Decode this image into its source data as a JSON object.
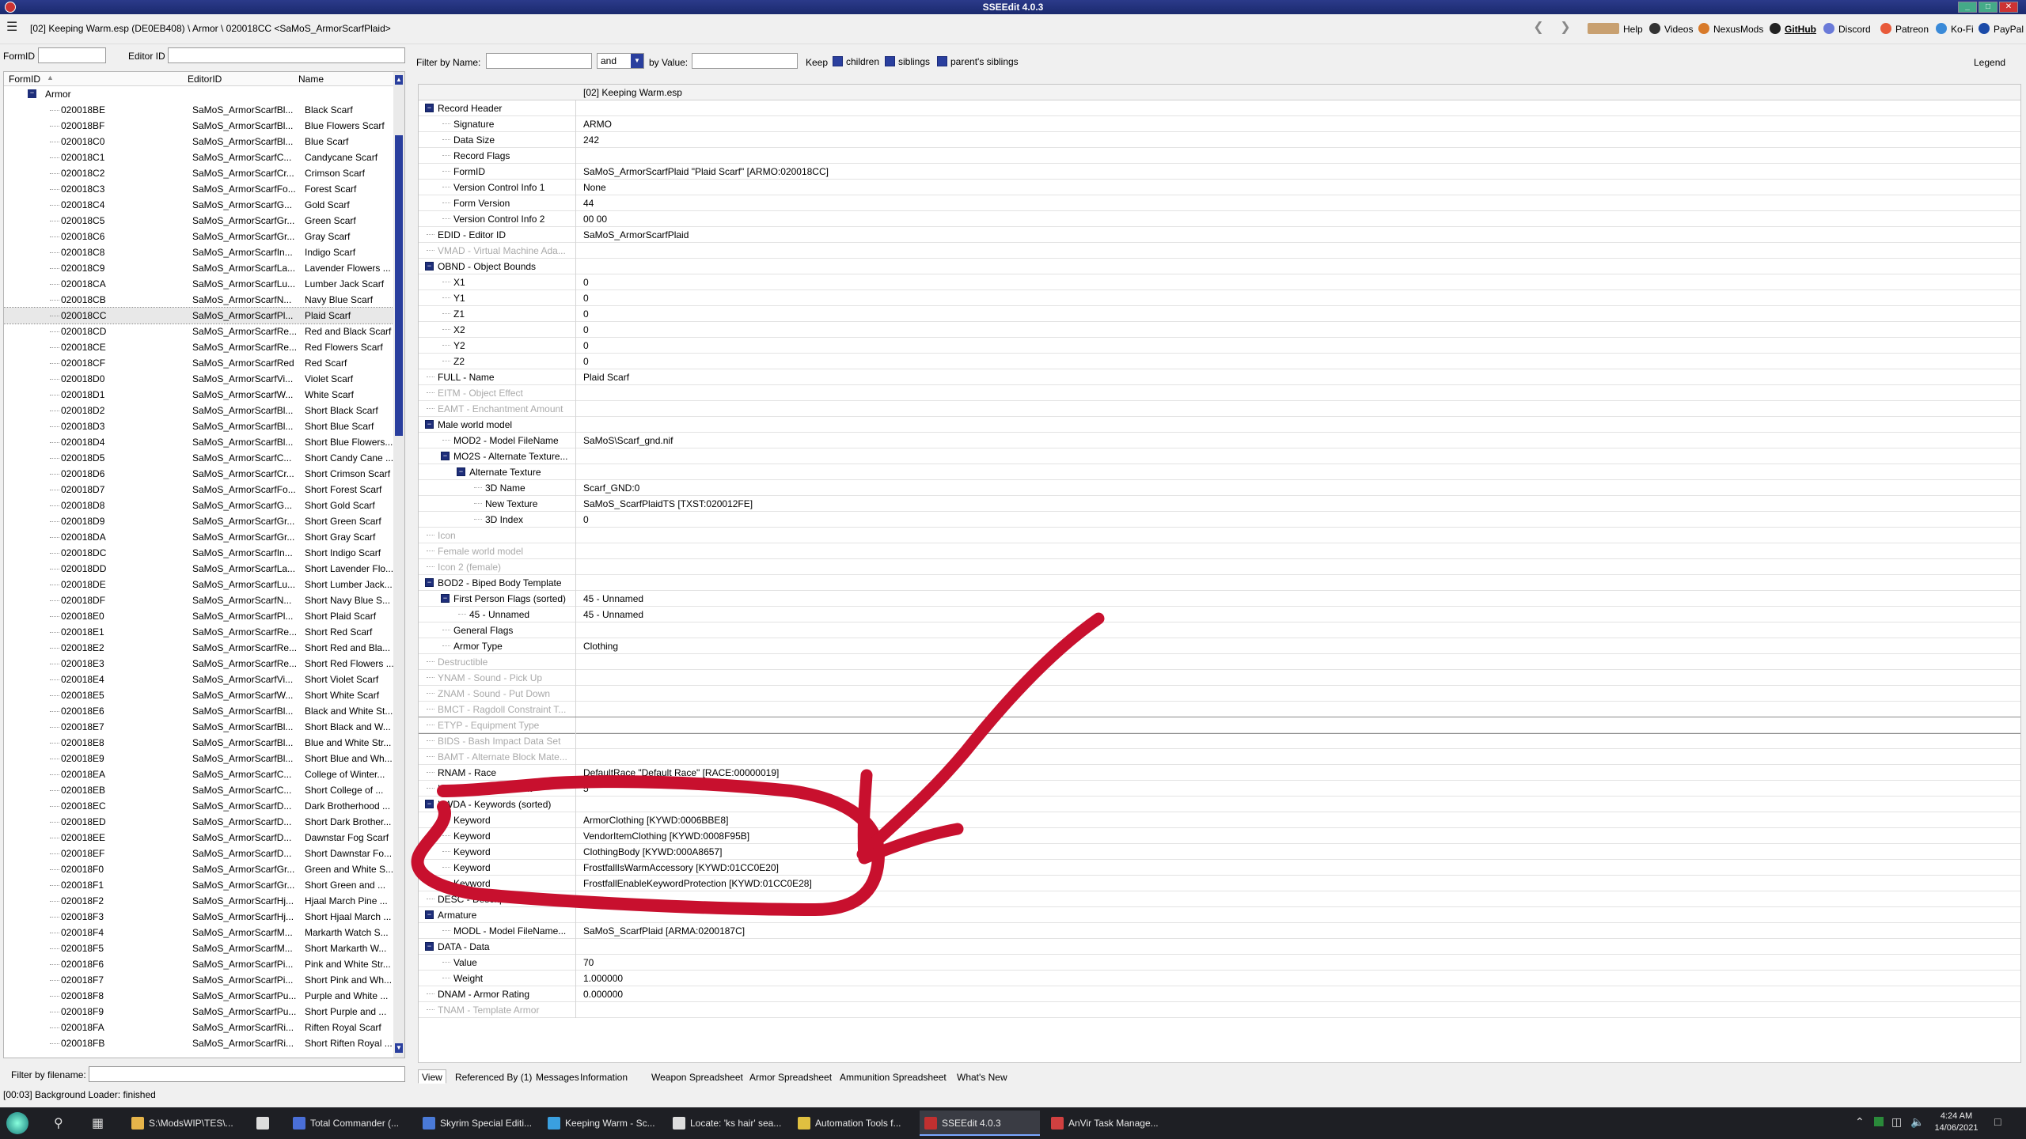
{
  "window": {
    "title": "SSEEdit 4.0.3",
    "controls": [
      "_",
      "□",
      "✕"
    ]
  },
  "toolbar": {
    "path": "[02] Keeping Warm.esp (DE0EB408) \\ Armor \\ 020018CC <SaMoS_ArmorScarfPlaid>",
    "links": [
      "Help",
      "Videos",
      "NexusMods",
      "GitHub",
      "Discord",
      "Patreon",
      "Ko-Fi",
      "PayPal"
    ]
  },
  "left": {
    "formid_label": "FormID",
    "editorid_label": "Editor ID",
    "formid_value": "",
    "editorid_value": "",
    "columns": [
      "FormID",
      "EditorID",
      "Name"
    ],
    "group": "Armor",
    "rows": [
      {
        "id": "020018BE",
        "eid": "SaMoS_ArmorScarfBl...",
        "name": "Black Scarf"
      },
      {
        "id": "020018BF",
        "eid": "SaMoS_ArmorScarfBl...",
        "name": "Blue Flowers Scarf"
      },
      {
        "id": "020018C0",
        "eid": "SaMoS_ArmorScarfBl...",
        "name": "Blue Scarf"
      },
      {
        "id": "020018C1",
        "eid": "SaMoS_ArmorScarfC...",
        "name": "Candycane Scarf"
      },
      {
        "id": "020018C2",
        "eid": "SaMoS_ArmorScarfCr...",
        "name": "Crimson Scarf"
      },
      {
        "id": "020018C3",
        "eid": "SaMoS_ArmorScarfFo...",
        "name": "Forest Scarf"
      },
      {
        "id": "020018C4",
        "eid": "SaMoS_ArmorScarfG...",
        "name": "Gold Scarf"
      },
      {
        "id": "020018C5",
        "eid": "SaMoS_ArmorScarfGr...",
        "name": "Green Scarf"
      },
      {
        "id": "020018C6",
        "eid": "SaMoS_ArmorScarfGr...",
        "name": "Gray Scarf"
      },
      {
        "id": "020018C8",
        "eid": "SaMoS_ArmorScarfIn...",
        "name": "Indigo Scarf"
      },
      {
        "id": "020018C9",
        "eid": "SaMoS_ArmorScarfLa...",
        "name": "Lavender Flowers ..."
      },
      {
        "id": "020018CA",
        "eid": "SaMoS_ArmorScarfLu...",
        "name": "Lumber Jack Scarf"
      },
      {
        "id": "020018CB",
        "eid": "SaMoS_ArmorScarfN...",
        "name": "Navy Blue Scarf"
      },
      {
        "id": "020018CC",
        "eid": "SaMoS_ArmorScarfPl...",
        "name": "Plaid Scarf",
        "selected": true
      },
      {
        "id": "020018CD",
        "eid": "SaMoS_ArmorScarfRe...",
        "name": "Red and Black Scarf"
      },
      {
        "id": "020018CE",
        "eid": "SaMoS_ArmorScarfRe...",
        "name": "Red Flowers Scarf"
      },
      {
        "id": "020018CF",
        "eid": "SaMoS_ArmorScarfRed",
        "name": "Red Scarf"
      },
      {
        "id": "020018D0",
        "eid": "SaMoS_ArmorScarfVi...",
        "name": "Violet Scarf"
      },
      {
        "id": "020018D1",
        "eid": "SaMoS_ArmorScarfW...",
        "name": "White Scarf"
      },
      {
        "id": "020018D2",
        "eid": "SaMoS_ArmorScarfBl...",
        "name": "Short Black Scarf"
      },
      {
        "id": "020018D3",
        "eid": "SaMoS_ArmorScarfBl...",
        "name": "Short Blue Scarf"
      },
      {
        "id": "020018D4",
        "eid": "SaMoS_ArmorScarfBl...",
        "name": "Short Blue Flowers..."
      },
      {
        "id": "020018D5",
        "eid": "SaMoS_ArmorScarfC...",
        "name": "Short Candy Cane ..."
      },
      {
        "id": "020018D6",
        "eid": "SaMoS_ArmorScarfCr...",
        "name": "Short Crimson Scarf"
      },
      {
        "id": "020018D7",
        "eid": "SaMoS_ArmorScarfFo...",
        "name": "Short Forest Scarf"
      },
      {
        "id": "020018D8",
        "eid": "SaMoS_ArmorScarfG...",
        "name": "Short Gold Scarf"
      },
      {
        "id": "020018D9",
        "eid": "SaMoS_ArmorScarfGr...",
        "name": "Short Green Scarf"
      },
      {
        "id": "020018DA",
        "eid": "SaMoS_ArmorScarfGr...",
        "name": "Short Gray Scarf"
      },
      {
        "id": "020018DC",
        "eid": "SaMoS_ArmorScarfIn...",
        "name": "Short Indigo Scarf"
      },
      {
        "id": "020018DD",
        "eid": "SaMoS_ArmorScarfLa...",
        "name": "Short Lavender Flo..."
      },
      {
        "id": "020018DE",
        "eid": "SaMoS_ArmorScarfLu...",
        "name": "Short Lumber Jack..."
      },
      {
        "id": "020018DF",
        "eid": "SaMoS_ArmorScarfN...",
        "name": "Short Navy Blue S..."
      },
      {
        "id": "020018E0",
        "eid": "SaMoS_ArmorScarfPl...",
        "name": "Short Plaid Scarf"
      },
      {
        "id": "020018E1",
        "eid": "SaMoS_ArmorScarfRe...",
        "name": "Short Red Scarf"
      },
      {
        "id": "020018E2",
        "eid": "SaMoS_ArmorScarfRe...",
        "name": "Short Red and Bla..."
      },
      {
        "id": "020018E3",
        "eid": "SaMoS_ArmorScarfRe...",
        "name": "Short Red Flowers ..."
      },
      {
        "id": "020018E4",
        "eid": "SaMoS_ArmorScarfVi...",
        "name": "Short Violet Scarf"
      },
      {
        "id": "020018E5",
        "eid": "SaMoS_ArmorScarfW...",
        "name": "Short White Scarf"
      },
      {
        "id": "020018E6",
        "eid": "SaMoS_ArmorScarfBl...",
        "name": "Black and White St..."
      },
      {
        "id": "020018E7",
        "eid": "SaMoS_ArmorScarfBl...",
        "name": "Short Black and W..."
      },
      {
        "id": "020018E8",
        "eid": "SaMoS_ArmorScarfBl...",
        "name": "Blue and White Str..."
      },
      {
        "id": "020018E9",
        "eid": "SaMoS_ArmorScarfBl...",
        "name": "Short Blue and Wh..."
      },
      {
        "id": "020018EA",
        "eid": "SaMoS_ArmorScarfC...",
        "name": "College of Winter..."
      },
      {
        "id": "020018EB",
        "eid": "SaMoS_ArmorScarfC...",
        "name": "Short College of ..."
      },
      {
        "id": "020018EC",
        "eid": "SaMoS_ArmorScarfD...",
        "name": "Dark Brotherhood ..."
      },
      {
        "id": "020018ED",
        "eid": "SaMoS_ArmorScarfD...",
        "name": "Short Dark Brother..."
      },
      {
        "id": "020018EE",
        "eid": "SaMoS_ArmorScarfD...",
        "name": "Dawnstar Fog Scarf"
      },
      {
        "id": "020018EF",
        "eid": "SaMoS_ArmorScarfD...",
        "name": "Short Dawnstar Fo..."
      },
      {
        "id": "020018F0",
        "eid": "SaMoS_ArmorScarfGr...",
        "name": "Green and White S..."
      },
      {
        "id": "020018F1",
        "eid": "SaMoS_ArmorScarfGr...",
        "name": "Short Green and ..."
      },
      {
        "id": "020018F2",
        "eid": "SaMoS_ArmorScarfHj...",
        "name": "Hjaal March Pine ..."
      },
      {
        "id": "020018F3",
        "eid": "SaMoS_ArmorScarfHj...",
        "name": "Short Hjaal March ..."
      },
      {
        "id": "020018F4",
        "eid": "SaMoS_ArmorScarfM...",
        "name": "Markarth Watch S..."
      },
      {
        "id": "020018F5",
        "eid": "SaMoS_ArmorScarfM...",
        "name": "Short Markarth W..."
      },
      {
        "id": "020018F6",
        "eid": "SaMoS_ArmorScarfPi...",
        "name": "Pink and White Str..."
      },
      {
        "id": "020018F7",
        "eid": "SaMoS_ArmorScarfPi...",
        "name": "Short Pink and Wh..."
      },
      {
        "id": "020018F8",
        "eid": "SaMoS_ArmorScarfPu...",
        "name": "Purple and White ..."
      },
      {
        "id": "020018F9",
        "eid": "SaMoS_ArmorScarfPu...",
        "name": "Short Purple and ..."
      },
      {
        "id": "020018FA",
        "eid": "SaMoS_ArmorScarfRi...",
        "name": "Riften Royal Scarf"
      },
      {
        "id": "020018FB",
        "eid": "SaMoS_ArmorScarfRi...",
        "name": "Short Riften Royal ..."
      }
    ],
    "filter_filename_label": "Filter by filename:",
    "filter_filename_value": ""
  },
  "right": {
    "filter_name_label": "Filter by Name:",
    "filter_name_value": "",
    "and_value": "and",
    "by_value_label": "by Value:",
    "by_value_value": "",
    "keep_label": "Keep",
    "children_label": "children",
    "siblings_label": "siblings",
    "parents_siblings_label": "parent's siblings",
    "legend_label": "Legend",
    "header": "[02] Keeping Warm.esp",
    "rows": [
      {
        "d": 0,
        "exp": true,
        "k": "Record Header",
        "v": ""
      },
      {
        "d": 1,
        "k": "Signature",
        "v": "ARMO"
      },
      {
        "d": 1,
        "k": "Data Size",
        "v": "242"
      },
      {
        "d": 1,
        "k": "Record Flags",
        "v": ""
      },
      {
        "d": 1,
        "k": "FormID",
        "v": "SaMoS_ArmorScarfPlaid \"Plaid Scarf\" [ARMO:020018CC]"
      },
      {
        "d": 1,
        "k": "Version Control Info 1",
        "v": "None"
      },
      {
        "d": 1,
        "k": "Form Version",
        "v": "44"
      },
      {
        "d": 1,
        "k": "Version Control Info 2",
        "v": "00 00"
      },
      {
        "d": 0,
        "k": "EDID - Editor ID",
        "v": "SaMoS_ArmorScarfPlaid"
      },
      {
        "d": 0,
        "dim": true,
        "k": "VMAD - Virtual Machine Ada...",
        "v": ""
      },
      {
        "d": 0,
        "exp": true,
        "k": "OBND - Object Bounds",
        "v": ""
      },
      {
        "d": 1,
        "k": "X1",
        "v": "0"
      },
      {
        "d": 1,
        "k": "Y1",
        "v": "0"
      },
      {
        "d": 1,
        "k": "Z1",
        "v": "0"
      },
      {
        "d": 1,
        "k": "X2",
        "v": "0"
      },
      {
        "d": 1,
        "k": "Y2",
        "v": "0"
      },
      {
        "d": 1,
        "k": "Z2",
        "v": "0"
      },
      {
        "d": 0,
        "k": "FULL - Name",
        "v": "Plaid Scarf"
      },
      {
        "d": 0,
        "dim": true,
        "k": "EITM - Object Effect",
        "v": ""
      },
      {
        "d": 0,
        "dim": true,
        "k": "EAMT - Enchantment Amount",
        "v": ""
      },
      {
        "d": 0,
        "exp": true,
        "k": "Male world model",
        "v": ""
      },
      {
        "d": 1,
        "k": "MOD2 - Model FileName",
        "v": "SaMoS\\Scarf_gnd.nif"
      },
      {
        "d": 1,
        "exp": true,
        "k": "MO2S - Alternate Texture...",
        "v": ""
      },
      {
        "d": 2,
        "exp": true,
        "k": "Alternate Texture",
        "v": ""
      },
      {
        "d": 3,
        "k": "3D Name",
        "v": "Scarf_GND:0"
      },
      {
        "d": 3,
        "k": "New Texture",
        "v": "SaMoS_ScarfPlaidTS [TXST:020012FE]"
      },
      {
        "d": 3,
        "k": "3D Index",
        "v": "0"
      },
      {
        "d": 0,
        "dim": true,
        "k": "Icon",
        "v": ""
      },
      {
        "d": 0,
        "dim": true,
        "k": "Female world model",
        "v": ""
      },
      {
        "d": 0,
        "dim": true,
        "k": "Icon 2 (female)",
        "v": ""
      },
      {
        "d": 0,
        "exp": true,
        "k": "BOD2 - Biped Body Template",
        "v": ""
      },
      {
        "d": 1,
        "exp": true,
        "k": "First Person Flags (sorted)",
        "v": "45 - Unnamed"
      },
      {
        "d": 2,
        "k": "45 - Unnamed",
        "v": "45 - Unnamed"
      },
      {
        "d": 1,
        "k": "General Flags",
        "v": ""
      },
      {
        "d": 1,
        "k": "Armor Type",
        "v": "Clothing"
      },
      {
        "d": 0,
        "dim": true,
        "k": "Destructible",
        "v": ""
      },
      {
        "d": 0,
        "dim": true,
        "k": "YNAM - Sound - Pick Up",
        "v": ""
      },
      {
        "d": 0,
        "dim": true,
        "k": "ZNAM - Sound - Put Down",
        "v": ""
      },
      {
        "d": 0,
        "dim": true,
        "k": "BMCT - Ragdoll Constraint T...",
        "v": ""
      },
      {
        "d": 0,
        "dim": true,
        "focus": true,
        "k": "ETYP - Equipment Type",
        "v": ""
      },
      {
        "d": 0,
        "dim": true,
        "k": "BIDS - Bash Impact Data Set",
        "v": ""
      },
      {
        "d": 0,
        "dim": true,
        "k": "BAMT - Alternate Block Mate...",
        "v": ""
      },
      {
        "d": 0,
        "k": "RNAM - Race",
        "v": "DefaultRace \"Default Race\" [RACE:00000019]"
      },
      {
        "d": 0,
        "k": "KSIZ - Keyword Count",
        "v": "5"
      },
      {
        "d": 0,
        "exp": true,
        "k": "KWDA - Keywords (sorted)",
        "v": ""
      },
      {
        "d": 1,
        "k": "Keyword",
        "v": "ArmorClothing [KYWD:0006BBE8]"
      },
      {
        "d": 1,
        "k": "Keyword",
        "v": "VendorItemClothing [KYWD:0008F95B]"
      },
      {
        "d": 1,
        "k": "Keyword",
        "v": "ClothingBody [KYWD:000A8657]"
      },
      {
        "d": 1,
        "k": "Keyword",
        "v": "FrostfallIsWarmAccessory [KYWD:01CC0E20]"
      },
      {
        "d": 1,
        "k": "Keyword",
        "v": "FrostfallEnableKeywordProtection [KYWD:01CC0E28]"
      },
      {
        "d": 0,
        "k": "DESC - Description",
        "v": ""
      },
      {
        "d": 0,
        "exp": true,
        "k": "Armature",
        "v": ""
      },
      {
        "d": 1,
        "k": "MODL - Model FileName...",
        "v": "SaMoS_ScarfPlaid [ARMA:0200187C]"
      },
      {
        "d": 0,
        "exp": true,
        "k": "DATA - Data",
        "v": ""
      },
      {
        "d": 1,
        "k": "Value",
        "v": "70"
      },
      {
        "d": 1,
        "k": "Weight",
        "v": "1.000000"
      },
      {
        "d": 0,
        "k": "DNAM - Armor Rating",
        "v": "0.000000"
      },
      {
        "d": 0,
        "dim": true,
        "k": "TNAM - Template Armor",
        "v": ""
      }
    ],
    "tabs": [
      "View",
      "Referenced By (1)",
      "Messages",
      "Information",
      "Weapon Spreadsheet",
      "Armor Spreadsheet",
      "Ammunition Spreadsheet",
      "What's New"
    ]
  },
  "status": "[00:03] Background Loader: finished",
  "taskbar": {
    "items": [
      {
        "label": "S:\\ModsWIP\\TES\\...",
        "icon": "folder-icon",
        "color": "#e6b44a"
      },
      {
        "label": "",
        "icon": "store-icon",
        "color": "#ddd"
      },
      {
        "label": "Total Commander (...",
        "icon": "disk-icon",
        "color": "#4a6fd8"
      },
      {
        "label": "Skyrim Special Editi...",
        "icon": "skyrim-icon",
        "color": "#4a7ad8"
      },
      {
        "label": "Keeping Warm - Sc...",
        "icon": "browser-icon",
        "color": "#3aa0e0"
      },
      {
        "label": "Locate: 'ks hair' sea...",
        "icon": "search-doc-icon",
        "color": "#ddd"
      },
      {
        "label": "Automation Tools f...",
        "icon": "notepad-icon",
        "color": "#e0c040"
      },
      {
        "label": "SSEEdit 4.0.3",
        "icon": "xedit-icon",
        "color": "#c03030",
        "active": true
      },
      {
        "label": "AnVir Task Manage...",
        "icon": "anvir-icon",
        "color": "#d04040"
      }
    ],
    "time": "4:24 AM",
    "date": "14/06/2021"
  },
  "annotation_color": "#c8102e"
}
